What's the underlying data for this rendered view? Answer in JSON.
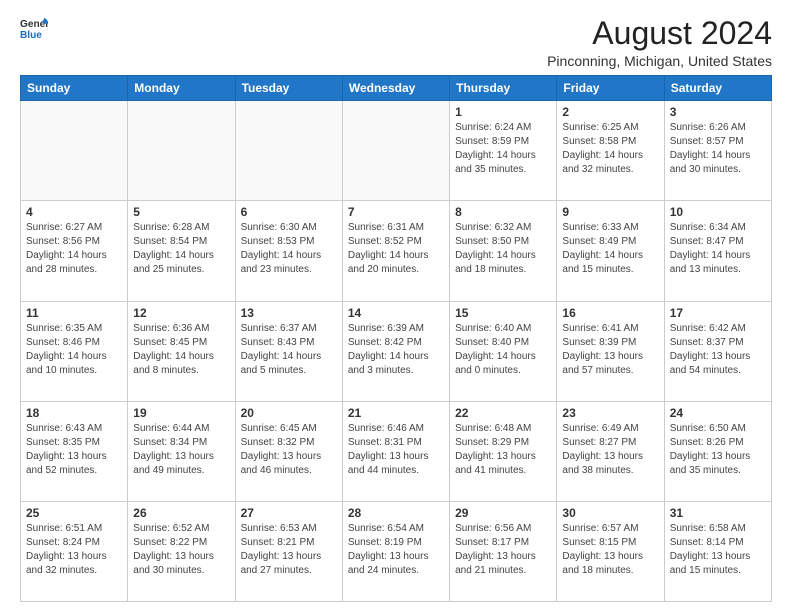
{
  "header": {
    "logo_line1": "General",
    "logo_line2": "Blue",
    "month": "August 2024",
    "location": "Pinconning, Michigan, United States"
  },
  "weekdays": [
    "Sunday",
    "Monday",
    "Tuesday",
    "Wednesday",
    "Thursday",
    "Friday",
    "Saturday"
  ],
  "weeks": [
    [
      {
        "day": "",
        "info": ""
      },
      {
        "day": "",
        "info": ""
      },
      {
        "day": "",
        "info": ""
      },
      {
        "day": "",
        "info": ""
      },
      {
        "day": "1",
        "info": "Sunrise: 6:24 AM\nSunset: 8:59 PM\nDaylight: 14 hours\nand 35 minutes."
      },
      {
        "day": "2",
        "info": "Sunrise: 6:25 AM\nSunset: 8:58 PM\nDaylight: 14 hours\nand 32 minutes."
      },
      {
        "day": "3",
        "info": "Sunrise: 6:26 AM\nSunset: 8:57 PM\nDaylight: 14 hours\nand 30 minutes."
      }
    ],
    [
      {
        "day": "4",
        "info": "Sunrise: 6:27 AM\nSunset: 8:56 PM\nDaylight: 14 hours\nand 28 minutes."
      },
      {
        "day": "5",
        "info": "Sunrise: 6:28 AM\nSunset: 8:54 PM\nDaylight: 14 hours\nand 25 minutes."
      },
      {
        "day": "6",
        "info": "Sunrise: 6:30 AM\nSunset: 8:53 PM\nDaylight: 14 hours\nand 23 minutes."
      },
      {
        "day": "7",
        "info": "Sunrise: 6:31 AM\nSunset: 8:52 PM\nDaylight: 14 hours\nand 20 minutes."
      },
      {
        "day": "8",
        "info": "Sunrise: 6:32 AM\nSunset: 8:50 PM\nDaylight: 14 hours\nand 18 minutes."
      },
      {
        "day": "9",
        "info": "Sunrise: 6:33 AM\nSunset: 8:49 PM\nDaylight: 14 hours\nand 15 minutes."
      },
      {
        "day": "10",
        "info": "Sunrise: 6:34 AM\nSunset: 8:47 PM\nDaylight: 14 hours\nand 13 minutes."
      }
    ],
    [
      {
        "day": "11",
        "info": "Sunrise: 6:35 AM\nSunset: 8:46 PM\nDaylight: 14 hours\nand 10 minutes."
      },
      {
        "day": "12",
        "info": "Sunrise: 6:36 AM\nSunset: 8:45 PM\nDaylight: 14 hours\nand 8 minutes."
      },
      {
        "day": "13",
        "info": "Sunrise: 6:37 AM\nSunset: 8:43 PM\nDaylight: 14 hours\nand 5 minutes."
      },
      {
        "day": "14",
        "info": "Sunrise: 6:39 AM\nSunset: 8:42 PM\nDaylight: 14 hours\nand 3 minutes."
      },
      {
        "day": "15",
        "info": "Sunrise: 6:40 AM\nSunset: 8:40 PM\nDaylight: 14 hours\nand 0 minutes."
      },
      {
        "day": "16",
        "info": "Sunrise: 6:41 AM\nSunset: 8:39 PM\nDaylight: 13 hours\nand 57 minutes."
      },
      {
        "day": "17",
        "info": "Sunrise: 6:42 AM\nSunset: 8:37 PM\nDaylight: 13 hours\nand 54 minutes."
      }
    ],
    [
      {
        "day": "18",
        "info": "Sunrise: 6:43 AM\nSunset: 8:35 PM\nDaylight: 13 hours\nand 52 minutes."
      },
      {
        "day": "19",
        "info": "Sunrise: 6:44 AM\nSunset: 8:34 PM\nDaylight: 13 hours\nand 49 minutes."
      },
      {
        "day": "20",
        "info": "Sunrise: 6:45 AM\nSunset: 8:32 PM\nDaylight: 13 hours\nand 46 minutes."
      },
      {
        "day": "21",
        "info": "Sunrise: 6:46 AM\nSunset: 8:31 PM\nDaylight: 13 hours\nand 44 minutes."
      },
      {
        "day": "22",
        "info": "Sunrise: 6:48 AM\nSunset: 8:29 PM\nDaylight: 13 hours\nand 41 minutes."
      },
      {
        "day": "23",
        "info": "Sunrise: 6:49 AM\nSunset: 8:27 PM\nDaylight: 13 hours\nand 38 minutes."
      },
      {
        "day": "24",
        "info": "Sunrise: 6:50 AM\nSunset: 8:26 PM\nDaylight: 13 hours\nand 35 minutes."
      }
    ],
    [
      {
        "day": "25",
        "info": "Sunrise: 6:51 AM\nSunset: 8:24 PM\nDaylight: 13 hours\nand 32 minutes."
      },
      {
        "day": "26",
        "info": "Sunrise: 6:52 AM\nSunset: 8:22 PM\nDaylight: 13 hours\nand 30 minutes."
      },
      {
        "day": "27",
        "info": "Sunrise: 6:53 AM\nSunset: 8:21 PM\nDaylight: 13 hours\nand 27 minutes."
      },
      {
        "day": "28",
        "info": "Sunrise: 6:54 AM\nSunset: 8:19 PM\nDaylight: 13 hours\nand 24 minutes."
      },
      {
        "day": "29",
        "info": "Sunrise: 6:56 AM\nSunset: 8:17 PM\nDaylight: 13 hours\nand 21 minutes."
      },
      {
        "day": "30",
        "info": "Sunrise: 6:57 AM\nSunset: 8:15 PM\nDaylight: 13 hours\nand 18 minutes."
      },
      {
        "day": "31",
        "info": "Sunrise: 6:58 AM\nSunset: 8:14 PM\nDaylight: 13 hours\nand 15 minutes."
      }
    ]
  ]
}
